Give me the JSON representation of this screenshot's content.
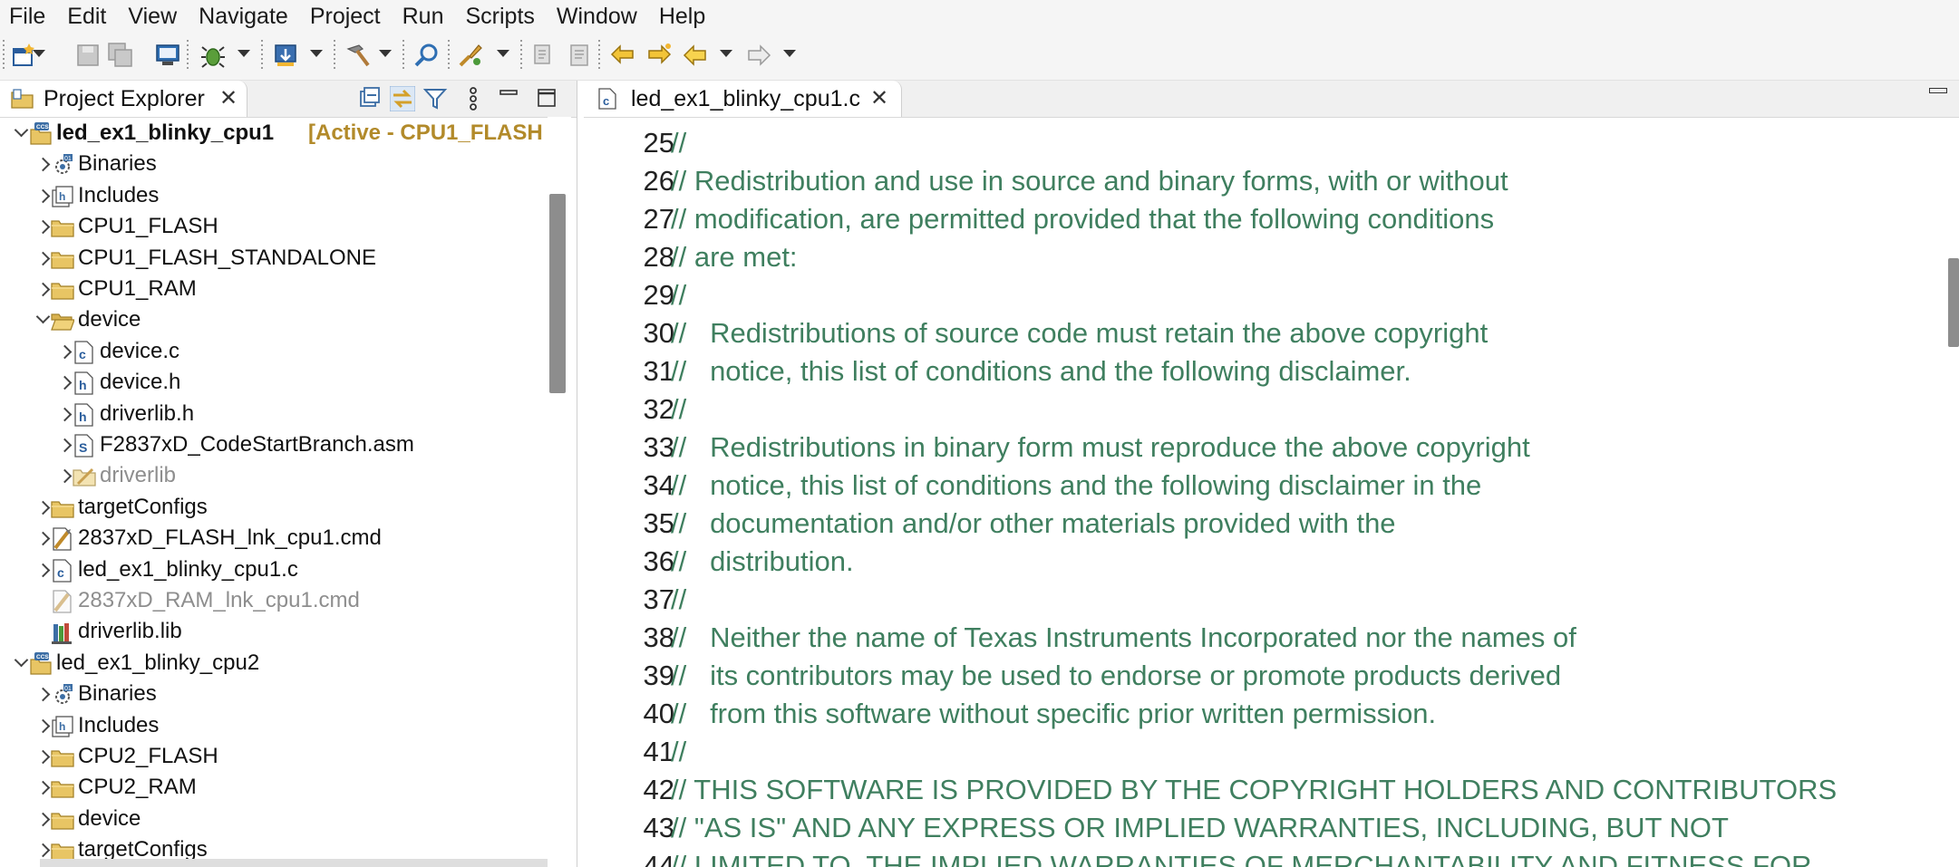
{
  "menu": [
    "File",
    "Edit",
    "View",
    "Navigate",
    "Project",
    "Run",
    "Scripts",
    "Window",
    "Help"
  ],
  "project_explorer": {
    "tab_label": "Project Explorer",
    "close_glyph": "✕",
    "tree": [
      {
        "label": "led_ex1_blinky_cpu1",
        "suffix": "[Active - CPU1_FLASH",
        "depth": 0,
        "twisty": "open",
        "icon": "ccs-project-icon",
        "bold": true
      },
      {
        "label": "Binaries",
        "depth": 1,
        "twisty": "closed",
        "icon": "binaries-icon"
      },
      {
        "label": "Includes",
        "depth": 1,
        "twisty": "closed",
        "icon": "includes-icon"
      },
      {
        "label": "CPU1_FLASH",
        "depth": 1,
        "twisty": "closed",
        "icon": "folder-icon"
      },
      {
        "label": "CPU1_FLASH_STANDALONE",
        "depth": 1,
        "twisty": "closed",
        "icon": "folder-icon"
      },
      {
        "label": "CPU1_RAM",
        "depth": 1,
        "twisty": "closed",
        "icon": "folder-icon"
      },
      {
        "label": "device",
        "depth": 1,
        "twisty": "open",
        "icon": "folder-open-icon"
      },
      {
        "label": "device.c",
        "depth": 2,
        "twisty": "closed",
        "icon": "c-file-icon"
      },
      {
        "label": "device.h",
        "depth": 2,
        "twisty": "closed",
        "icon": "h-file-icon"
      },
      {
        "label": "driverlib.h",
        "depth": 2,
        "twisty": "closed",
        "icon": "h-file-icon"
      },
      {
        "label": "F2837xD_CodeStartBranch.asm",
        "depth": 2,
        "twisty": "closed",
        "icon": "asm-file-icon"
      },
      {
        "label": "driverlib",
        "depth": 2,
        "twisty": "closed",
        "icon": "excluded-folder-icon",
        "disabled": true
      },
      {
        "label": "targetConfigs",
        "depth": 1,
        "twisty": "closed",
        "icon": "folder-icon"
      },
      {
        "label": "2837xD_FLASH_lnk_cpu1.cmd",
        "depth": 1,
        "twisty": "closed",
        "icon": "cmd-file-icon"
      },
      {
        "label": "led_ex1_blinky_cpu1.c",
        "depth": 1,
        "twisty": "closed",
        "icon": "c-file-icon"
      },
      {
        "label": "2837xD_RAM_lnk_cpu1.cmd",
        "depth": 1,
        "twisty": "none",
        "icon": "cmd-file-excluded-icon",
        "disabled": true
      },
      {
        "label": "driverlib.lib",
        "depth": 1,
        "twisty": "none",
        "icon": "lib-file-icon"
      },
      {
        "label": "led_ex1_blinky_cpu2",
        "depth": 0,
        "twisty": "open",
        "icon": "ccs-project-icon"
      },
      {
        "label": "Binaries",
        "depth": 1,
        "twisty": "closed",
        "icon": "binaries-icon"
      },
      {
        "label": "Includes",
        "depth": 1,
        "twisty": "closed",
        "icon": "includes-icon"
      },
      {
        "label": "CPU2_FLASH",
        "depth": 1,
        "twisty": "closed",
        "icon": "folder-icon"
      },
      {
        "label": "CPU2_RAM",
        "depth": 1,
        "twisty": "closed",
        "icon": "folder-icon"
      },
      {
        "label": "device",
        "depth": 1,
        "twisty": "closed",
        "icon": "folder-icon"
      },
      {
        "label": "targetConfigs",
        "depth": 1,
        "twisty": "closed",
        "icon": "folder-icon"
      }
    ]
  },
  "editor": {
    "tab_label": "led_ex1_blinky_cpu1.c",
    "close_glyph": "✕",
    "lines": [
      {
        "n": "25",
        "text": "//"
      },
      {
        "n": "26",
        "text": "// Redistribution and use in source and binary forms, with or without"
      },
      {
        "n": "27",
        "text": "// modification, are permitted provided that the following conditions"
      },
      {
        "n": "28",
        "text": "// are met:"
      },
      {
        "n": "29",
        "text": "//"
      },
      {
        "n": "30",
        "text": "//   Redistributions of source code must retain the above copyright"
      },
      {
        "n": "31",
        "text": "//   notice, this list of conditions and the following disclaimer."
      },
      {
        "n": "32",
        "text": "//"
      },
      {
        "n": "33",
        "text": "//   Redistributions in binary form must reproduce the above copyright"
      },
      {
        "n": "34",
        "text": "//   notice, this list of conditions and the following disclaimer in the"
      },
      {
        "n": "35",
        "text": "//   documentation and/or other materials provided with the"
      },
      {
        "n": "36",
        "text": "//   distribution."
      },
      {
        "n": "37",
        "text": "//"
      },
      {
        "n": "38",
        "text": "//   Neither the name of Texas Instruments Incorporated nor the names of"
      },
      {
        "n": "39",
        "text": "//   its contributors may be used to endorse or promote products derived"
      },
      {
        "n": "40",
        "text": "//   from this software without specific prior written permission."
      },
      {
        "n": "41",
        "text": "//"
      },
      {
        "n": "42",
        "text": "// THIS SOFTWARE IS PROVIDED BY THE COPYRIGHT HOLDERS AND CONTRIBUTORS"
      },
      {
        "n": "43",
        "text": "// \"AS IS\" AND ANY EXPRESS OR IMPLIED WARRANTIES, INCLUDING, BUT NOT"
      },
      {
        "n": "44",
        "text": "// LIMITED TO, THE IMPLIED WARRANTIES OF MERCHANTABILITY AND FITNESS FOR"
      }
    ]
  },
  "colors": {
    "comment": "#3f7f5f",
    "active_tag": "#b28a2a",
    "disabled": "#8e8e8e",
    "folder": "#e8c564"
  }
}
